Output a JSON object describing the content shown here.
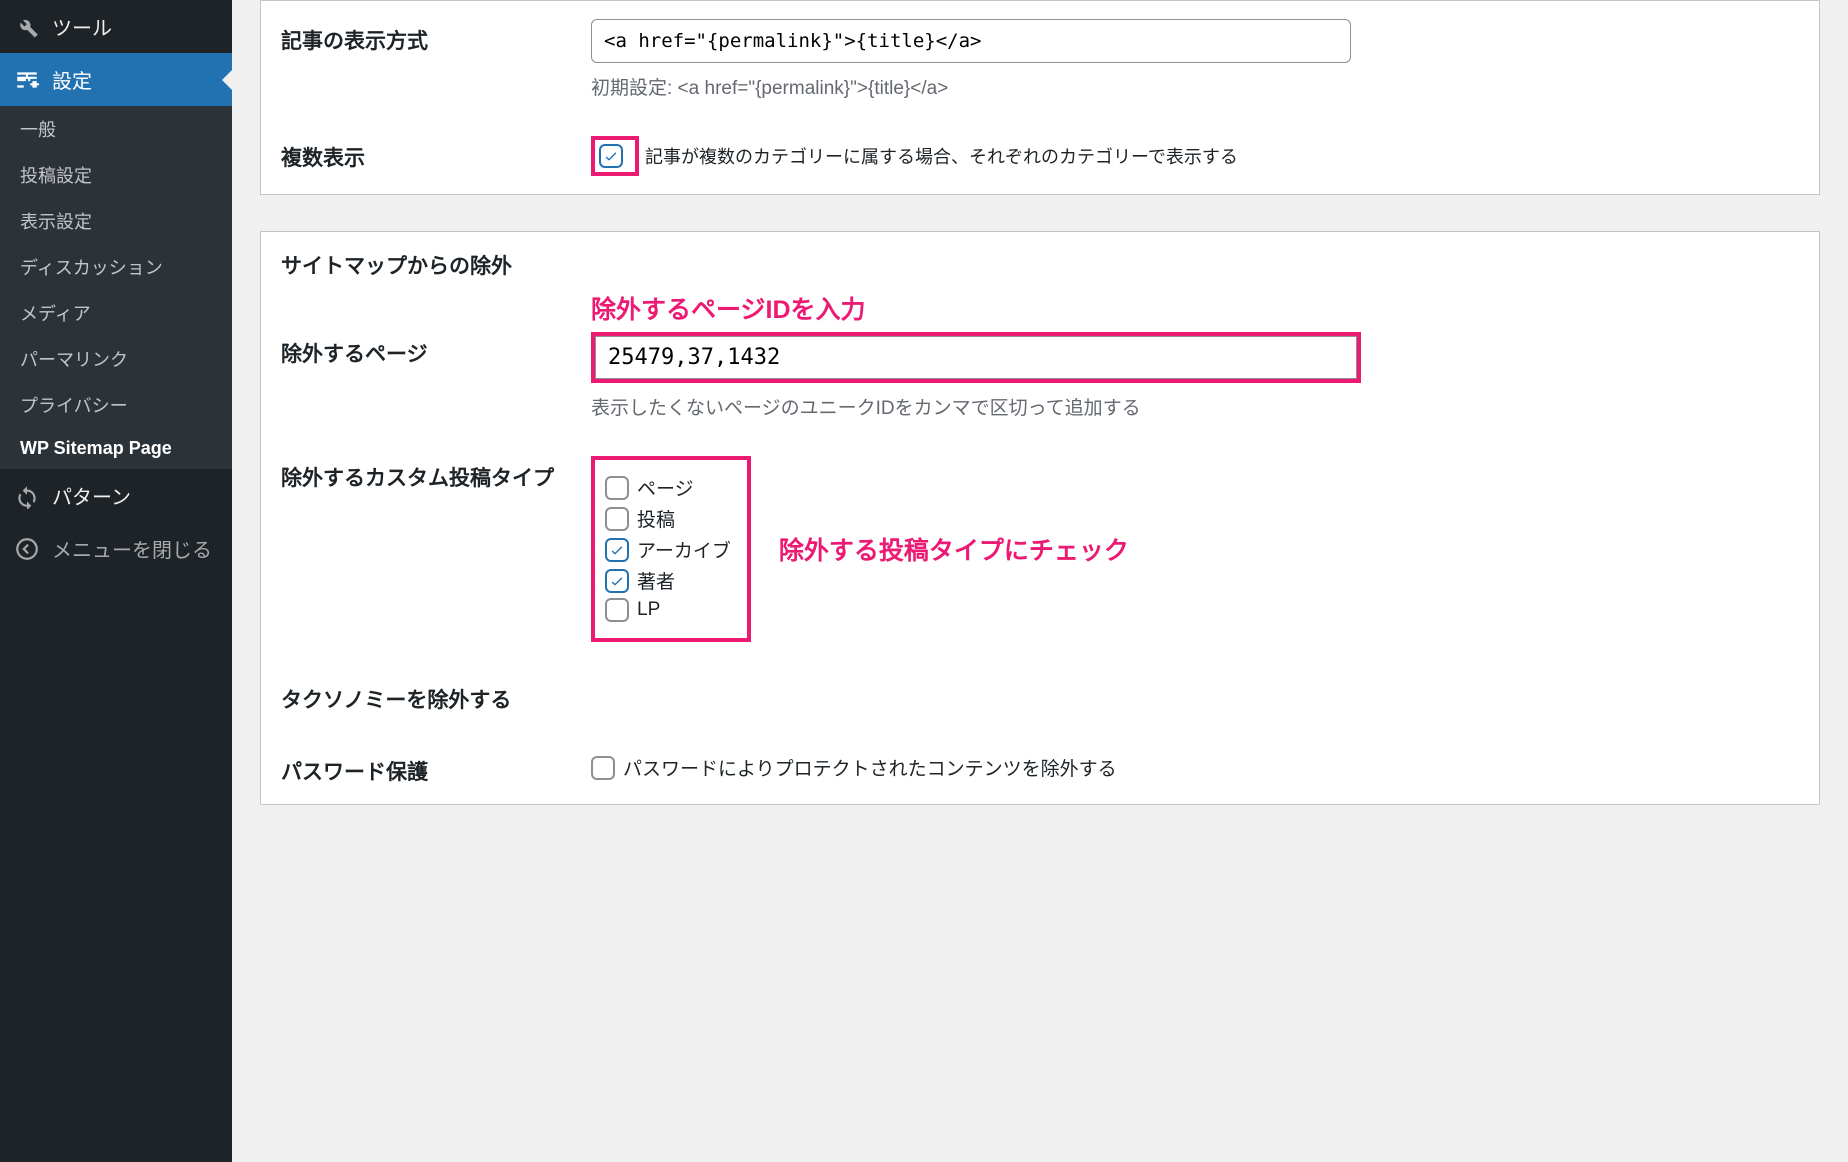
{
  "sidebar": {
    "tools": "ツール",
    "settings": "設定",
    "subitems": {
      "general": "一般",
      "writing": "投稿設定",
      "reading": "表示設定",
      "discussion": "ディスカッション",
      "media": "メディア",
      "permalink": "パーマリンク",
      "privacy": "プライバシー",
      "wp_sitemap": "WP Sitemap Page"
    },
    "patterns": "パターン",
    "collapse": "メニューを閉じる"
  },
  "form": {
    "display_format_label": "記事の表示方式",
    "display_format_value": "<a href=\"{permalink}\">{title}</a>",
    "display_format_hint": "初期設定: <a href=\"{permalink}\">{title}</a>",
    "multi_display_label": "複数表示",
    "multi_display_text": "記事が複数のカテゴリーに属する場合、それぞれのカテゴリーで表示する",
    "exclude_section_label": "サイトマップからの除外",
    "exclude_page_label": "除外するページ",
    "exclude_page_value": "25479,37,1432",
    "exclude_page_hint": "表示したくないページのユニークIDをカンマで区切って追加する",
    "exclude_cpt_label": "除外するカスタム投稿タイプ",
    "cpt_options": {
      "page": "ページ",
      "post": "投稿",
      "archive": "アーカイブ",
      "author": "著者",
      "lp": "LP"
    },
    "exclude_tax_label": "タクソノミーを除外する",
    "password_label": "パスワード保護",
    "password_text": "パスワードによりプロテクトされたコンテンツを除外する"
  },
  "annotations": {
    "anno1": "除外するページIDを入力",
    "anno2": "除外する投稿タイプにチェック"
  }
}
